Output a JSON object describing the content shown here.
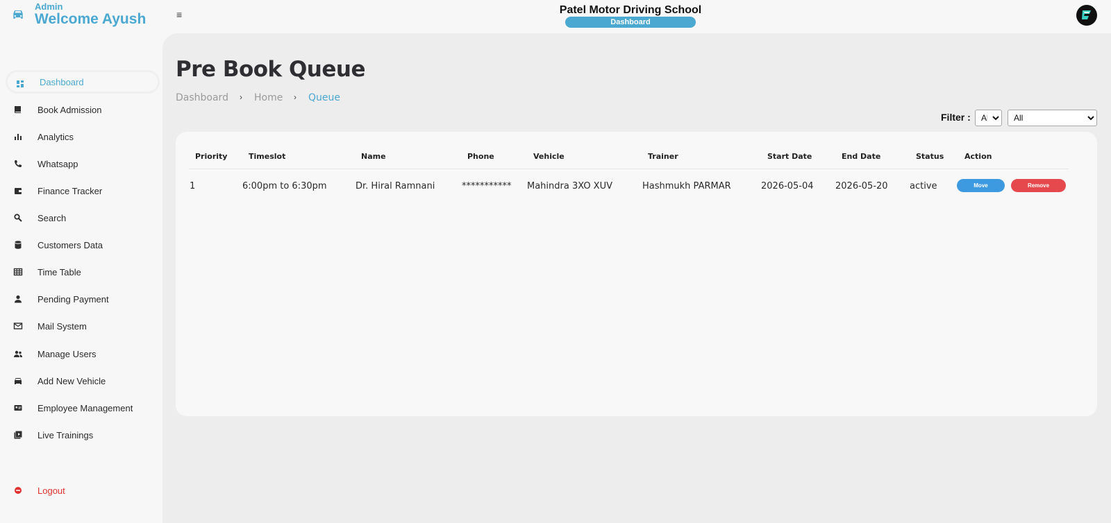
{
  "header": {
    "role": "Admin",
    "welcome": "Welcome Ayush",
    "school_name": "Patel Motor Driving School",
    "badge": "Dashboard",
    "accent_color": "#4aa8d1"
  },
  "sidebar": {
    "items": [
      {
        "label": "Dashboard",
        "icon": "dashboard-icon"
      },
      {
        "label": "Book Admission",
        "icon": "book-icon"
      },
      {
        "label": "Analytics",
        "icon": "bar-chart-icon"
      },
      {
        "label": "Whatsapp",
        "icon": "phone-icon"
      },
      {
        "label": "Finance Tracker",
        "icon": "wallet-icon"
      },
      {
        "label": "Search",
        "icon": "search-icon"
      },
      {
        "label": "Customers Data",
        "icon": "database-icon"
      },
      {
        "label": "Time Table",
        "icon": "table-icon"
      },
      {
        "label": "Pending Payment",
        "icon": "person-icon"
      },
      {
        "label": "Mail System",
        "icon": "mail-icon"
      },
      {
        "label": "Manage Users",
        "icon": "users-icon"
      },
      {
        "label": "Add New Vehicle",
        "icon": "car-icon"
      },
      {
        "label": "Employee Management",
        "icon": "id-card-icon"
      },
      {
        "label": "Live Trainings",
        "icon": "video-library-icon"
      }
    ],
    "logout": "Logout"
  },
  "main": {
    "title": "Pre Book Queue",
    "breadcrumb": [
      "Dashboard",
      "Home",
      "Queue"
    ],
    "filter": {
      "label": "Filter :",
      "first_value": "All",
      "second_value": "All"
    },
    "table": {
      "headers": [
        "Priority",
        "Timeslot",
        "Name",
        "Phone",
        "Vehicle",
        "Trainer",
        "Start Date",
        "End Date",
        "Status",
        "Action"
      ],
      "rows": [
        {
          "priority": "1",
          "timeslot": "6:00pm to 6:30pm",
          "name": "Dr. Hiral Ramnani",
          "phone": "***********",
          "vehicle": "Mahindra 3XO XUV",
          "trainer": "Hashmukh PARMAR",
          "start_date": "2026-05-04",
          "end_date": "2026-05-20",
          "status": "active",
          "move_label": "Move",
          "remove_label": "Remove"
        }
      ]
    }
  }
}
